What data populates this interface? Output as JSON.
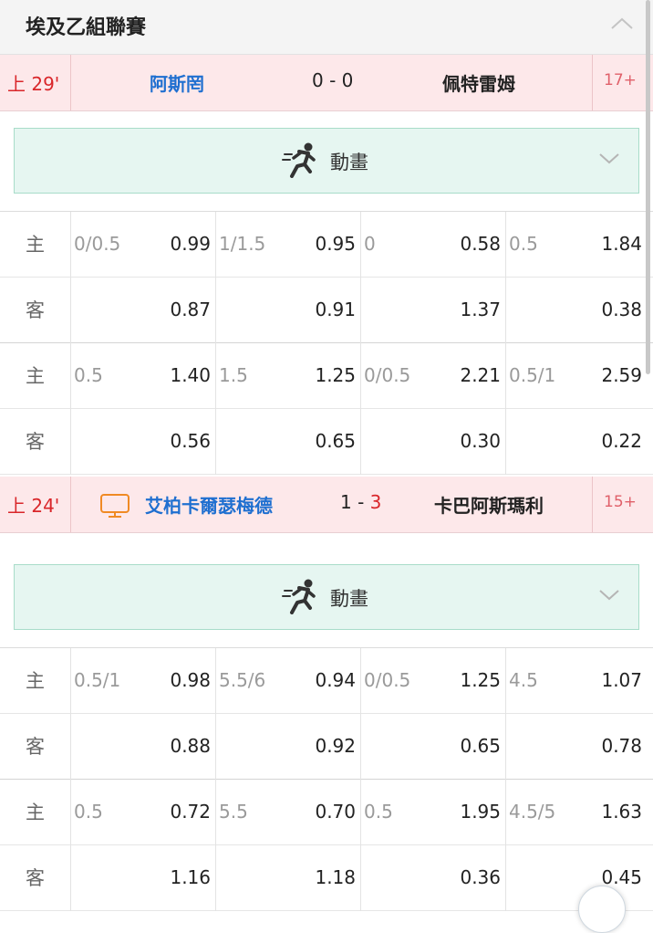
{
  "league": {
    "title": "埃及乙組聯賽",
    "collapse_icon": "chevron-up-icon"
  },
  "animation_label": "動畫",
  "matches": [
    {
      "time": "上 29'",
      "home": "阿斯罔",
      "score_home": "0",
      "score_sep": " - ",
      "score_away": "0",
      "away": "佩特雷姆",
      "more": "17+",
      "odds": [
        {
          "home_label": "主",
          "away_label": "客",
          "cols": [
            {
              "hcap": "0/0.5",
              "home": "0.99",
              "away": "0.87"
            },
            {
              "hcap": "1/1.5",
              "home": "0.95",
              "away": "0.91"
            },
            {
              "hcap": "0",
              "home": "0.58",
              "away": "1.37"
            },
            {
              "hcap": "0.5",
              "home": "1.84",
              "away": "0.38"
            }
          ]
        },
        {
          "home_label": "主",
          "away_label": "客",
          "cols": [
            {
              "hcap": "0.5",
              "home": "1.40",
              "away": "0.56"
            },
            {
              "hcap": "1.5",
              "home": "1.25",
              "away": "0.65"
            },
            {
              "hcap": "0/0.5",
              "home": "2.21",
              "away": "0.30"
            },
            {
              "hcap": "0.5/1",
              "home": "2.59",
              "away": "0.22"
            }
          ]
        }
      ]
    },
    {
      "time": "上 24'",
      "home": "艾柏卡爾瑟梅德",
      "score_home": "1",
      "score_sep": " - ",
      "score_away": "3",
      "away": "卡巴阿斯瑪利",
      "more": "15+",
      "odds": [
        {
          "home_label": "主",
          "away_label": "客",
          "cols": [
            {
              "hcap": "0.5/1",
              "home": "0.98",
              "away": "0.88"
            },
            {
              "hcap": "5.5/6",
              "home": "0.94",
              "away": "0.92"
            },
            {
              "hcap": "0/0.5",
              "home": "1.25",
              "away": "0.65"
            },
            {
              "hcap": "4.5",
              "home": "1.07",
              "away": "0.78"
            }
          ]
        },
        {
          "home_label": "主",
          "away_label": "客",
          "cols": [
            {
              "hcap": "0.5",
              "home": "0.72",
              "away": "1.16"
            },
            {
              "hcap": "5.5",
              "home": "0.70",
              "away": "1.18"
            },
            {
              "hcap": "0.5",
              "home": "1.95",
              "away": "0.36"
            },
            {
              "hcap": "4.5/5",
              "home": "1.63",
              "away": "0.45"
            }
          ]
        }
      ]
    }
  ],
  "colors": {
    "live_time": "#d9262a",
    "home_team": "#1f6fd0",
    "match_bg": "#fde8ea",
    "anim_bg": "#e6f6f1"
  }
}
